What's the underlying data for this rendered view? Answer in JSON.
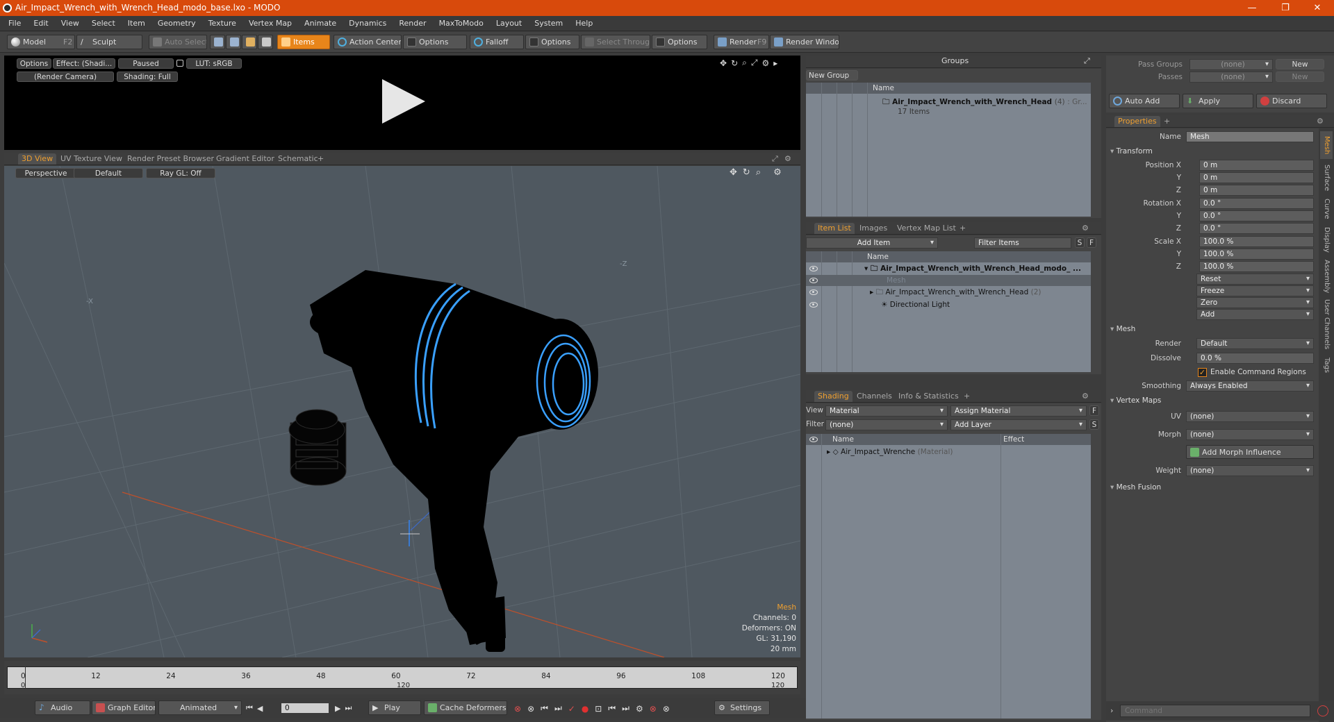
{
  "title": "Air_Impact_Wrench_with_Wrench_Head_modo_base.lxo - MODO",
  "menu": [
    "File",
    "Edit",
    "View",
    "Select",
    "Item",
    "Geometry",
    "Texture",
    "Vertex Map",
    "Animate",
    "Dynamics",
    "Render",
    "MaxToModo",
    "Layout",
    "System",
    "Help"
  ],
  "toolbar": {
    "model": "Model",
    "model_key": "F2",
    "sculpt": "Sculpt",
    "auto_select": "Auto Select",
    "items": "Items",
    "action_center": "Action Center",
    "options1": "Options",
    "falloff": "Falloff",
    "options2": "Options",
    "select_through": "Select Through",
    "options3": "Options",
    "render": "Render",
    "render_key": "F9",
    "render_window": "Render Window"
  },
  "preview": {
    "options": "Options",
    "effect": "Effect: (Shadi...",
    "paused": "Paused",
    "lut": "LUT: sRGB",
    "camera": "(Render Camera)",
    "shading": "Shading: Full"
  },
  "viewport_tabs": [
    "3D View",
    "UV Texture View",
    "Render Preset Browser",
    "Gradient Editor",
    "Schematic"
  ],
  "viewport": {
    "perspective": "Perspective",
    "default": "Default",
    "raygl": "Ray GL: Off",
    "axis_x": "-X",
    "axis_z": "-Z",
    "info": {
      "mesh": "Mesh",
      "channels": "Channels: 0",
      "deformers": "Deformers: ON",
      "gl": "GL: 31,190",
      "size": "20 mm"
    }
  },
  "timeline": {
    "ticks": [
      "0",
      "12",
      "24",
      "36",
      "48",
      "60",
      "72",
      "84",
      "96",
      "108",
      "120"
    ],
    "sub_left": "0",
    "sub_mid": "120",
    "sub_right": "120"
  },
  "transport": {
    "audio": "Audio",
    "graph_editor": "Graph Editor",
    "animated": "Animated",
    "frame": "0",
    "play": "Play",
    "cache": "Cache Deformers",
    "settings": "Settings"
  },
  "groups": {
    "header": "Groups",
    "new_group": "New Group",
    "col_name": "Name",
    "item_name": "Air_Impact_Wrench_with_Wrench_Head",
    "item_count": "(4)",
    "item_suffix": ": Gr...",
    "item_sub": "17 Items"
  },
  "item_list": {
    "tabs": [
      "Item List",
      "Images",
      "Vertex Map List"
    ],
    "add_item": "Add Item",
    "filter": "Filter Items",
    "s": "S",
    "f": "F",
    "col_name": "Name",
    "rows": [
      {
        "name": "Air_Impact_Wrench_with_Wrench_Head_modo_ ...",
        "suffix": ""
      },
      {
        "name": "Mesh",
        "suffix": ""
      },
      {
        "name": "Air_Impact_Wrench_with_Wrench_Head",
        "suffix": "(2)"
      },
      {
        "name": "Directional Light",
        "suffix": ""
      }
    ]
  },
  "shading": {
    "tabs": [
      "Shading",
      "Channels",
      "Info & Statistics"
    ],
    "view_label": "View",
    "view_value": "Material",
    "assign": "Assign Material",
    "f": "F",
    "filter_label": "Filter",
    "filter_value": "(none)",
    "add_layer": "Add Layer",
    "s": "S",
    "col_name": "Name",
    "col_effect": "Effect",
    "row_name": "Air_Impact_Wrenche",
    "row_type": "(Material)"
  },
  "passes": {
    "groups_label": "Pass Groups",
    "groups_value": "(none)",
    "new1": "New",
    "passes_label": "Passes",
    "passes_value": "(none)",
    "new2": "New",
    "auto_add": "Auto Add",
    "apply": "Apply",
    "discard": "Discard"
  },
  "properties": {
    "tab": "Properties",
    "name_label": "Name",
    "name_value": "Mesh",
    "transform": "Transform",
    "pos_label": "Position X",
    "y": "Y",
    "z": "Z",
    "pos": [
      "0 m",
      "0 m",
      "0 m"
    ],
    "rot_label": "Rotation X",
    "rot": [
      "0.0 °",
      "0.0 °",
      "0.0 °"
    ],
    "scale_label": "Scale X",
    "scale": [
      "100.0 %",
      "100.0 %",
      "100.0 %"
    ],
    "reset": "Reset",
    "freeze": "Freeze",
    "zero": "Zero",
    "add": "Add",
    "mesh": "Mesh",
    "render_label": "Render",
    "render_value": "Default",
    "dissolve_label": "Dissolve",
    "dissolve_value": "0.0 %",
    "enable_cmd": "Enable Command Regions",
    "smoothing_label": "Smoothing",
    "smoothing_value": "Always Enabled",
    "vertex_maps": "Vertex Maps",
    "uv_label": "UV",
    "uv_value": "(none)",
    "morph_label": "Morph",
    "morph_value": "(none)",
    "add_morph": "Add Morph Influence",
    "weight_label": "Weight",
    "weight_value": "(none)",
    "mesh_fusion": "Mesh Fusion",
    "side_tabs": [
      "Mesh",
      "Surface",
      "Curve",
      "Display",
      "Assembly",
      "User Channels",
      "Tags"
    ]
  },
  "command_placeholder": "Command",
  "colors": {
    "accent": "#f0a030",
    "title": "#d84a0c",
    "wire": "#3aa0ff"
  }
}
